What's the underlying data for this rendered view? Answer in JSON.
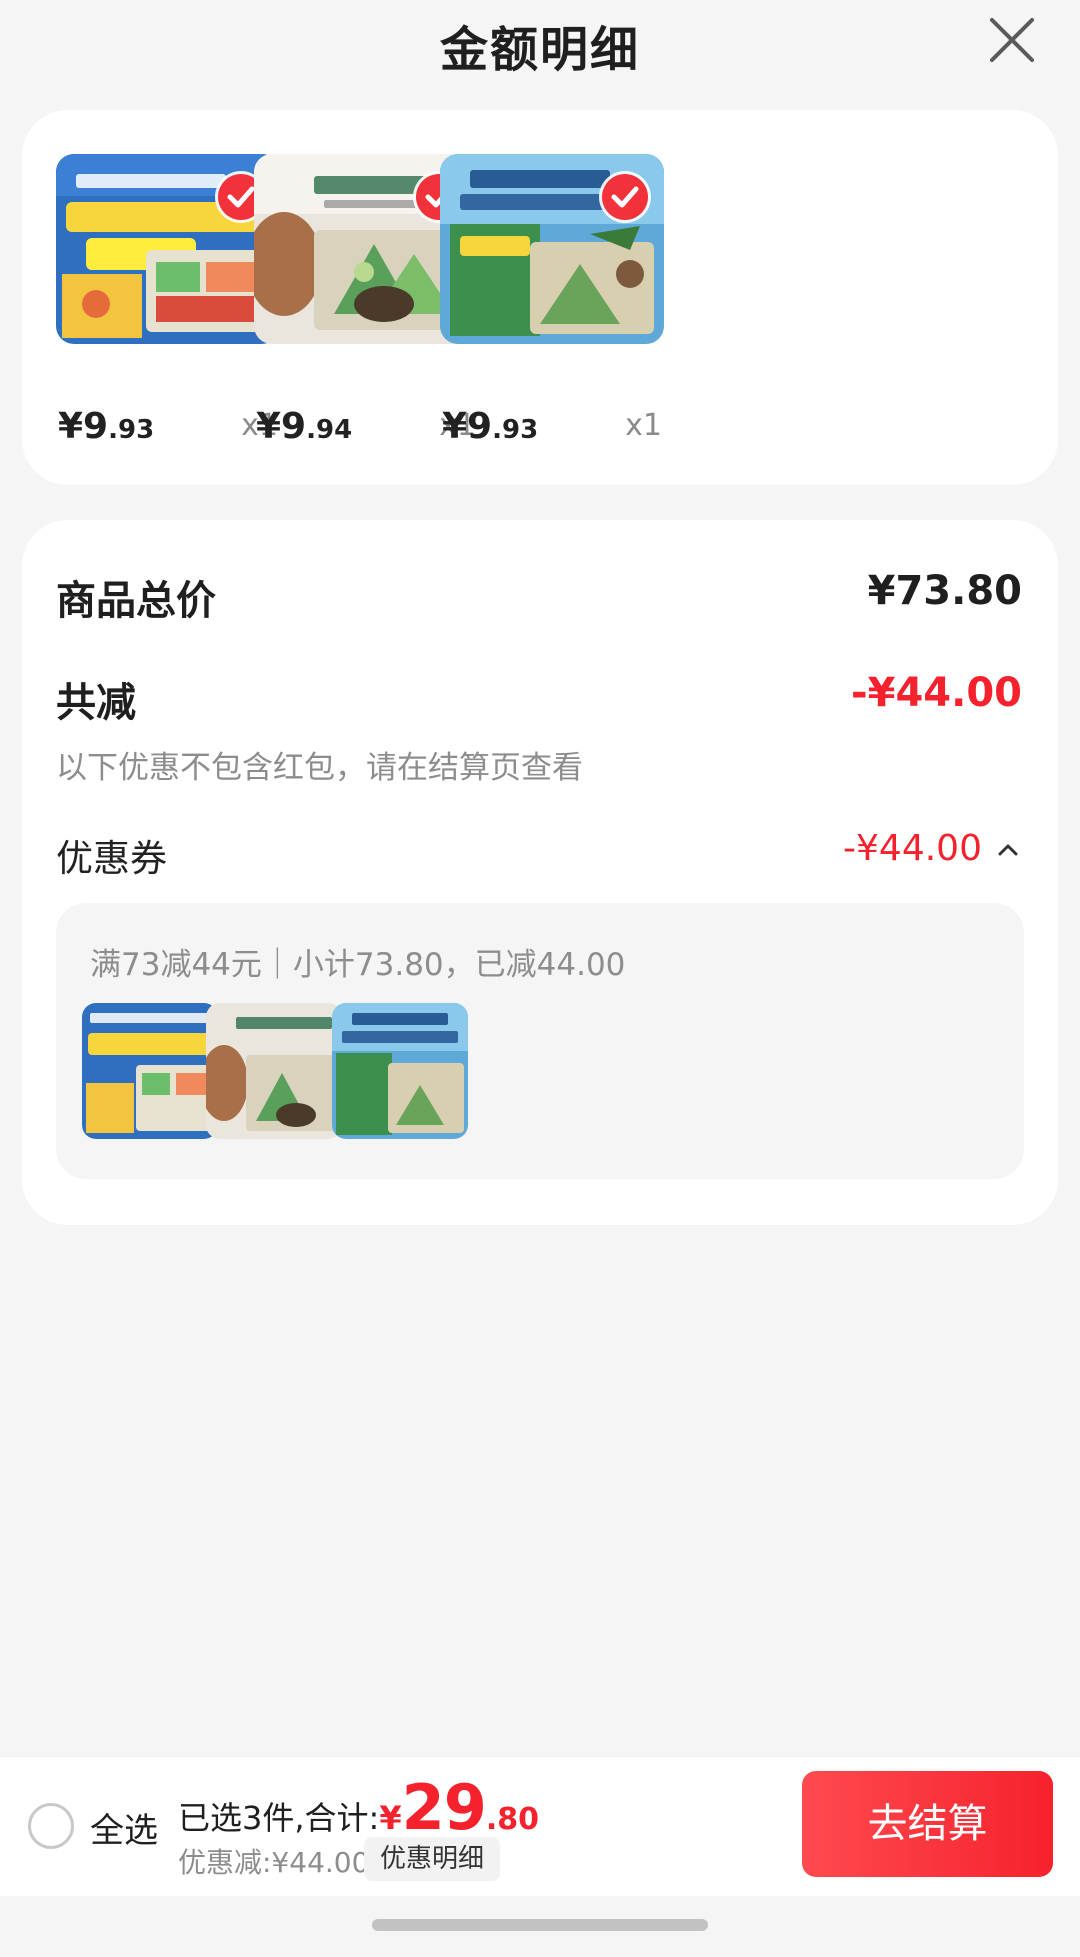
{
  "header": {
    "title": "金额明细",
    "close_icon": "close-icon"
  },
  "products": [
    {
      "price_main": "¥9",
      "price_cents": ".93",
      "qty": "x1",
      "image": "book-cover-colors",
      "checked": true
    },
    {
      "price_main": "¥9",
      "price_cents": ".94",
      "qty": "x1",
      "image": "book-cover-popup-forest",
      "checked": true
    },
    {
      "price_main": "¥9",
      "price_cents": ".93",
      "qty": "x1",
      "image": "book-cover-animals",
      "checked": true
    }
  ],
  "details": {
    "total_label": "商品总价",
    "total_value": "¥73.80",
    "reduce_label": "共减",
    "reduce_value": "-¥44.00",
    "note": "以下优惠不包含红包，请在结算页查看",
    "coupon_label": "优惠券",
    "coupon_value": "-¥44.00",
    "coupon_detail": "满73减44元｜小计73.80，已减44.00"
  },
  "bottom": {
    "select_all": "全选",
    "summary_label": "已选3件,合计:",
    "currency": "¥",
    "total_int": "29",
    "total_dec": ".80",
    "discount_text": "优惠减:¥44.00",
    "discount_detail_button": "优惠明细",
    "checkout_button": "去结算"
  },
  "colors": {
    "accent": "#f5222d",
    "background": "#f5f5f5"
  }
}
